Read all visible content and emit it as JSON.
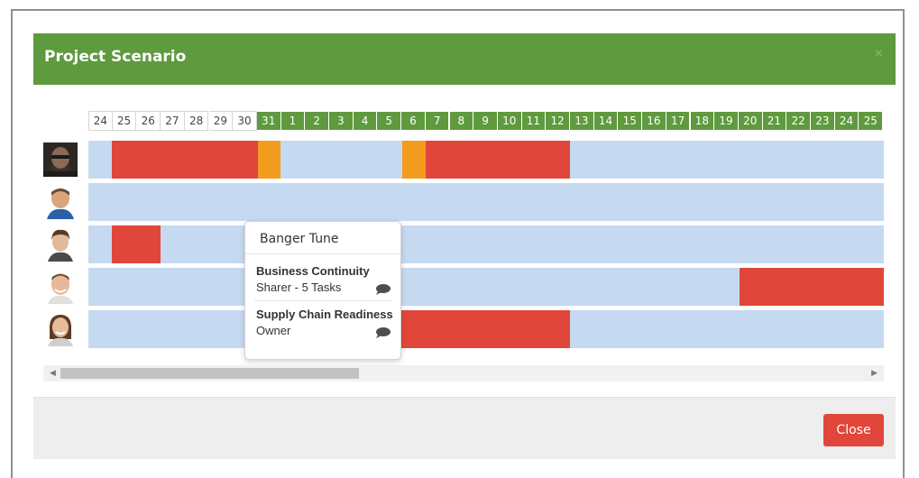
{
  "modal": {
    "title": "Project Scenario",
    "close_x": "×",
    "close_button": "Close"
  },
  "timeline": {
    "days": [
      "24",
      "25",
      "26",
      "27",
      "28",
      "29",
      "30",
      "31",
      "1",
      "2",
      "3",
      "4",
      "5",
      "6",
      "7",
      "8",
      "9",
      "10",
      "11",
      "12",
      "13",
      "14",
      "15",
      "16",
      "17",
      "18",
      "19",
      "20",
      "21",
      "22",
      "23",
      "24",
      "25"
    ],
    "highlighted_from_index": 7
  },
  "colors": {
    "header_green": "#5f9a3e",
    "bar_red": "#e0473a",
    "bar_orange": "#f39c1f",
    "row_blue": "#c5d9f0",
    "button_red": "#e0463a"
  },
  "popup": {
    "title": "Banger Tune",
    "tasks": [
      {
        "name": "Business Continuity",
        "role": "Sharer - 5 Tasks",
        "icon": "comment-icon"
      },
      {
        "name": "Supply Chain Readiness",
        "role": "Owner",
        "icon": "comment-icon"
      }
    ]
  },
  "people": [
    {
      "avatar": "person-avatar-1"
    },
    {
      "avatar": "person-avatar-2"
    },
    {
      "avatar": "person-avatar-3"
    },
    {
      "avatar": "person-avatar-4"
    },
    {
      "avatar": "person-avatar-5"
    }
  ]
}
